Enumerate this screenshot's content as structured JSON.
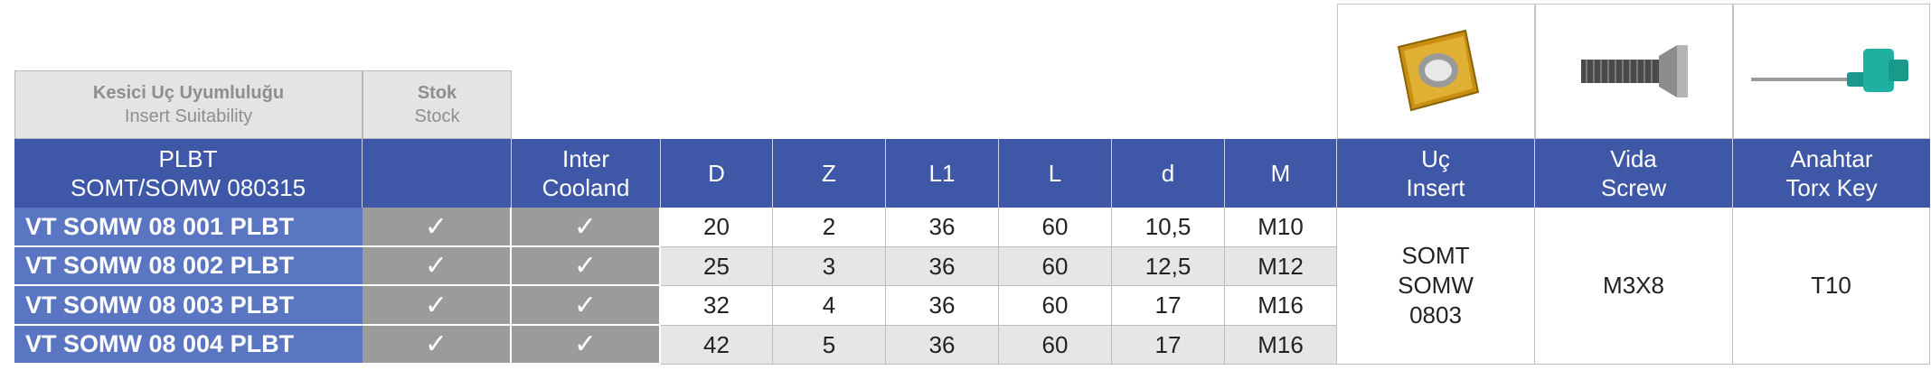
{
  "top_headers": {
    "suitability_tr": "Kesici Uç Uyumluluğu",
    "suitability_en": "Insert Suitability",
    "stock_tr": "Stok",
    "stock_en": "Stock"
  },
  "columns": {
    "product_line1": "PLBT",
    "product_line2": "SOMT/SOMW 080315",
    "stock": "",
    "cooling_line1": "Inter",
    "cooling_line2": "Cooland",
    "D": "D",
    "Z": "Z",
    "L1": "L1",
    "L": "L",
    "d": "d",
    "M": "M",
    "insert_line1": "Uç",
    "insert_line2": "Insert",
    "screw_line1": "Vida",
    "screw_line2": "Screw",
    "key_line1": "Anahtar",
    "key_line2": "Torx Key"
  },
  "rows": [
    {
      "name": "VT SOMW 08 001 PLBT",
      "stock": "✓",
      "cooling": "✓",
      "D": "20",
      "Z": "2",
      "L1": "36",
      "L": "60",
      "d": "10,5",
      "M": "M10"
    },
    {
      "name": "VT SOMW 08 002 PLBT",
      "stock": "✓",
      "cooling": "✓",
      "D": "25",
      "Z": "3",
      "L1": "36",
      "L": "60",
      "d": "12,5",
      "M": "M12"
    },
    {
      "name": "VT SOMW 08 003 PLBT",
      "stock": "✓",
      "cooling": "✓",
      "D": "32",
      "Z": "4",
      "L1": "36",
      "L": "60",
      "d": "17",
      "M": "M16"
    },
    {
      "name": "VT SOMW 08 004 PLBT",
      "stock": "✓",
      "cooling": "✓",
      "D": "42",
      "Z": "5",
      "L1": "36",
      "L": "60",
      "d": "17",
      "M": "M16"
    }
  ],
  "merged": {
    "insert_line1": "SOMT",
    "insert_line2": "SOMW",
    "insert_line3": "0803",
    "screw": "M3X8",
    "key": "T10"
  },
  "images": {
    "insert": "insert-image",
    "screw": "screw-image",
    "key": "torx-key-image"
  },
  "colors": {
    "header_blue": "#3f57a7",
    "name_blue": "#5a76c2",
    "check_gray": "#9b9b9b",
    "insert_gold": "#d4a21c",
    "key_teal": "#1fa89a"
  }
}
